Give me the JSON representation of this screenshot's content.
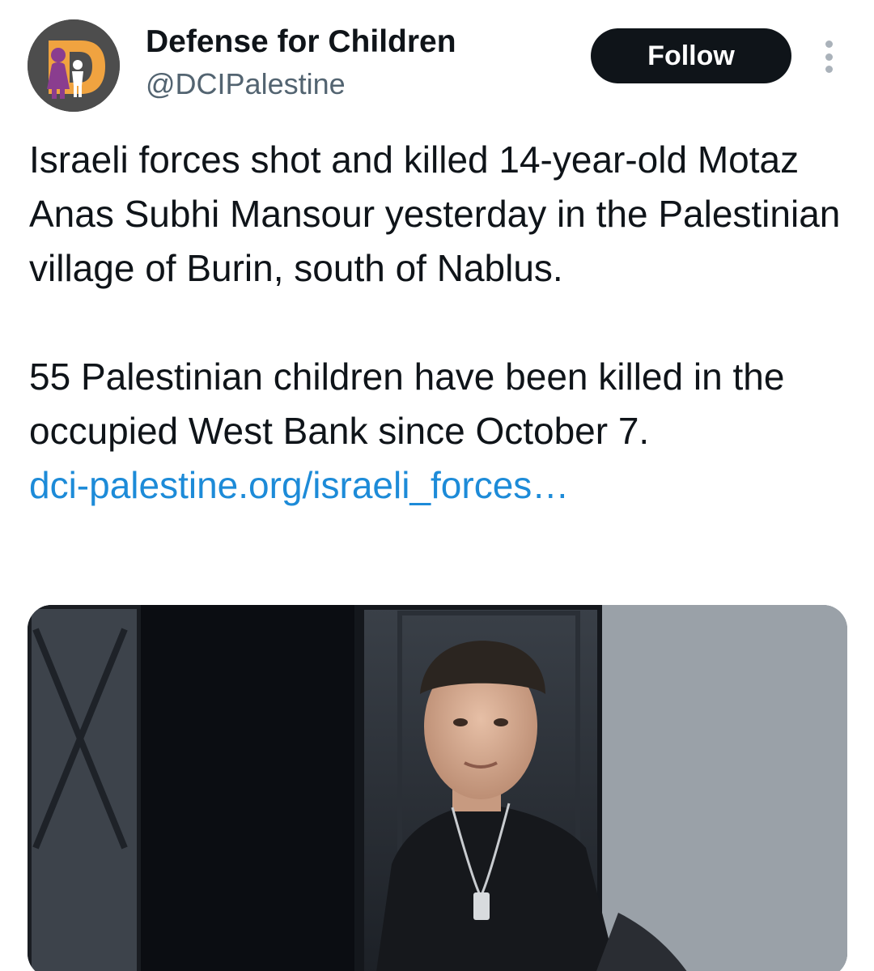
{
  "account": {
    "display_name": "Defense for Children",
    "handle": "@DCIPalestine",
    "avatar_icon": "dci-logo-icon",
    "avatar_letter": "D"
  },
  "actions": {
    "follow_label": "Follow",
    "more_icon": "more-vertical-icon"
  },
  "tweet": {
    "paragraph_1": "Israeli forces shot and killed 14-year-old Motaz Anas Subhi Mansour yesterday in the Palestinian village of Burin, south of Nablus.",
    "paragraph_2": "55 Palestinian children have been killed in the occupied West Bank since October 7.",
    "link_text": "dci-palestine.org/israeli_forces…"
  },
  "media": {
    "type": "photo"
  },
  "colors": {
    "background": "#ffffff",
    "text_primary": "#0f1419",
    "text_secondary": "#536471",
    "link": "#1d8bd8",
    "follow_bg": "#0f1419",
    "follow_text": "#ffffff",
    "logo_orange": "#f0a340",
    "logo_purple": "#8a3d8f"
  }
}
